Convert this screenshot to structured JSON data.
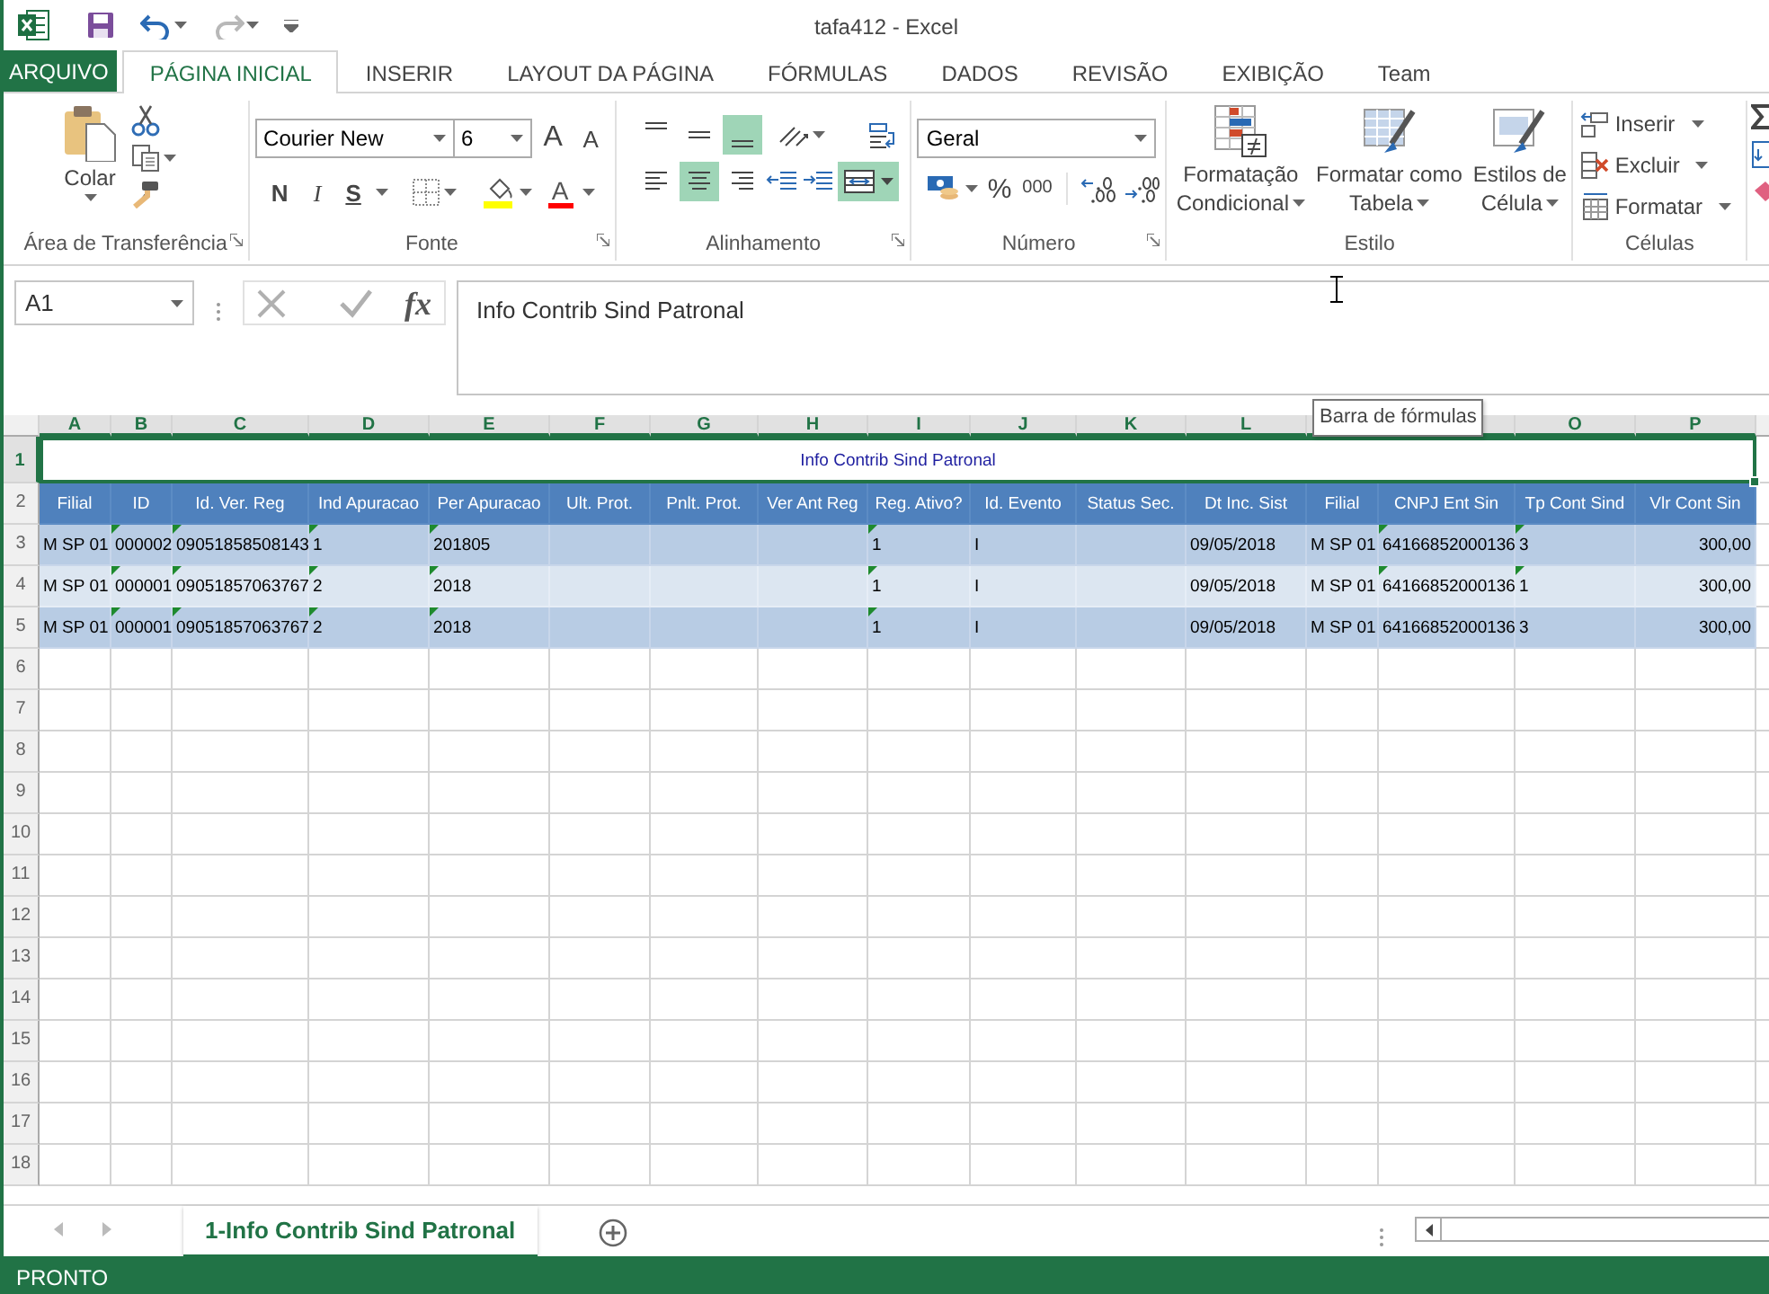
{
  "window": {
    "title": "tafa412 - Excel"
  },
  "quick_access": [
    {
      "kind": "save",
      "disabled": false
    },
    {
      "kind": "undo",
      "disabled": false
    },
    {
      "kind": "redo",
      "disabled": true
    }
  ],
  "file_tab": "ARQUIVO",
  "tabs": [
    {
      "label": "PÁGINA INICIAL",
      "selected": true
    },
    {
      "label": "INSERIR",
      "selected": false
    },
    {
      "label": "LAYOUT DA PÁGINA",
      "selected": false
    },
    {
      "label": "FÓRMULAS",
      "selected": false
    },
    {
      "label": "DADOS",
      "selected": false
    },
    {
      "label": "REVISÃO",
      "selected": false
    },
    {
      "label": "EXIBIÇÃO",
      "selected": false
    },
    {
      "label": "Team",
      "selected": false
    }
  ],
  "ribbon": {
    "clipboard": {
      "paste": "Colar",
      "label": "Área de Transferência"
    },
    "font": {
      "name": "Courier New",
      "size": "6",
      "grow": "A",
      "shrink": "A",
      "bold": "N",
      "italic": "I",
      "underline": "S",
      "color_button": "A",
      "label": "Fonte"
    },
    "alignment": {
      "label": "Alinhamento",
      "vertical": [
        {
          "kind": "top",
          "selected": false
        },
        {
          "kind": "middle",
          "selected": false
        },
        {
          "kind": "bottom",
          "selected": true
        }
      ],
      "horizontal": [
        {
          "kind": "left",
          "selected": false
        },
        {
          "kind": "center",
          "selected": true
        },
        {
          "kind": "right",
          "selected": false
        }
      ],
      "merge_selected": true
    },
    "number": {
      "format": "Geral",
      "percent": "%",
      "thousands": "000",
      "label": "Número"
    },
    "styles": {
      "label": "Estilo",
      "buttons": [
        {
          "kind": "conditional",
          "lines": [
            "Formatação",
            "Condicional"
          ]
        },
        {
          "kind": "table",
          "lines": [
            "Formatar como",
            "Tabela"
          ]
        },
        {
          "kind": "cell",
          "lines": [
            "Estilos de",
            "Célula"
          ]
        }
      ]
    },
    "cells": {
      "label": "Células",
      "buttons": [
        {
          "kind": "insert",
          "label": "Inserir"
        },
        {
          "kind": "delete",
          "label": "Excluir"
        },
        {
          "kind": "format",
          "label": "Formatar"
        }
      ]
    }
  },
  "formula_bar": {
    "name_box": "A1",
    "function_button": "fx",
    "formula": "Info Contrib Sind Patronal",
    "tooltip": "Barra de fórmulas"
  },
  "sheet": {
    "column_headers": [
      {
        "label": "A",
        "selected": true
      },
      {
        "label": "B",
        "selected": true
      },
      {
        "label": "C",
        "selected": true
      },
      {
        "label": "D",
        "selected": true
      },
      {
        "label": "E",
        "selected": true
      },
      {
        "label": "F",
        "selected": true
      },
      {
        "label": "G",
        "selected": true
      },
      {
        "label": "H",
        "selected": true
      },
      {
        "label": "I",
        "selected": true
      },
      {
        "label": "J",
        "selected": true
      },
      {
        "label": "K",
        "selected": true
      },
      {
        "label": "L",
        "selected": true
      },
      {
        "selected": true
      },
      {
        "selected": true
      },
      {
        "label": "O",
        "selected": true
      },
      {
        "label": "P",
        "selected": true
      }
    ],
    "rows": [
      {
        "number": "1",
        "selected": true,
        "kind": "title",
        "text": "Info Contrib Sind Patronal"
      },
      {
        "number": "2",
        "selected": false,
        "kind": "header",
        "cells": [
          "Filial",
          "ID",
          "Id. Ver. Reg",
          "Ind Apuracao",
          "Per Apuracao",
          "Ult. Prot.",
          "Pnlt. Prot.",
          "Ver Ant Reg",
          "Reg. Ativo?",
          "Id. Evento",
          "Status Sec.",
          "Dt Inc. Sist",
          "Filial",
          "CNPJ Ent Sin",
          "Tp Cont Sind",
          "Vlr Cont Sin"
        ]
      },
      {
        "number": "3",
        "selected": false,
        "kind": "data",
        "cells": [
          {
            "text": "M SP 01",
            "flag": false
          },
          {
            "text": "000002",
            "flag": true
          },
          {
            "text": "09051858508143",
            "flag": true
          },
          {
            "text": "1",
            "flag": true
          },
          {
            "text": "201805",
            "flag": true
          },
          {
            "flag": false
          },
          {
            "flag": false
          },
          {
            "flag": false
          },
          {
            "text": "1",
            "flag": true
          },
          {
            "text": "I",
            "flag": false
          },
          {
            "flag": false
          },
          {
            "text": "09/05/2018",
            "flag": false
          },
          {
            "text": "M SP 01",
            "flag": false
          },
          {
            "text": "64166852000136",
            "flag": true
          },
          {
            "text": "3",
            "flag": true
          },
          {
            "text": "300,00",
            "flag": false
          }
        ]
      },
      {
        "number": "4",
        "selected": false,
        "kind": "data",
        "cells": [
          {
            "text": "M SP 01",
            "flag": false
          },
          {
            "text": "000001",
            "flag": true
          },
          {
            "text": "09051857063767",
            "flag": true
          },
          {
            "text": "2",
            "flag": true
          },
          {
            "text": "2018",
            "flag": true
          },
          {
            "flag": false
          },
          {
            "flag": false
          },
          {
            "flag": false
          },
          {
            "text": "1",
            "flag": true
          },
          {
            "text": "I",
            "flag": false
          },
          {
            "flag": false
          },
          {
            "text": "09/05/2018",
            "flag": false
          },
          {
            "text": "M SP 01",
            "flag": false
          },
          {
            "text": "64166852000136",
            "flag": true
          },
          {
            "text": "1",
            "flag": true
          },
          {
            "text": "300,00",
            "flag": false
          }
        ]
      },
      {
        "number": "5",
        "selected": false,
        "kind": "data",
        "cells": [
          {
            "text": "M SP 01",
            "flag": false
          },
          {
            "text": "000001",
            "flag": true
          },
          {
            "text": "09051857063767",
            "flag": true
          },
          {
            "text": "2",
            "flag": true
          },
          {
            "text": "2018",
            "flag": true
          },
          {
            "flag": false
          },
          {
            "flag": false
          },
          {
            "flag": false
          },
          {
            "text": "1",
            "flag": true
          },
          {
            "text": "I",
            "flag": false
          },
          {
            "flag": false
          },
          {
            "text": "09/05/2018",
            "flag": false
          },
          {
            "text": "M SP 01",
            "flag": false
          },
          {
            "text": "64166852000136",
            "flag": false
          },
          {
            "text": "3",
            "flag": false
          },
          {
            "text": "300,00",
            "flag": false
          }
        ]
      },
      {
        "number": "6",
        "selected": false,
        "kind": "empty"
      },
      {
        "number": "7",
        "selected": false,
        "kind": "empty"
      },
      {
        "number": "8",
        "selected": false,
        "kind": "empty"
      },
      {
        "number": "9",
        "selected": false,
        "kind": "empty"
      },
      {
        "number": "10",
        "selected": false,
        "kind": "empty"
      },
      {
        "number": "11",
        "selected": false,
        "kind": "empty"
      },
      {
        "number": "12",
        "selected": false,
        "kind": "empty"
      },
      {
        "number": "13",
        "selected": false,
        "kind": "empty"
      },
      {
        "number": "14",
        "selected": false,
        "kind": "empty"
      },
      {
        "number": "15",
        "selected": false,
        "kind": "empty"
      },
      {
        "number": "16",
        "selected": false,
        "kind": "empty"
      },
      {
        "number": "17",
        "selected": false,
        "kind": "empty"
      },
      {
        "number": "18",
        "selected": false,
        "kind": "empty"
      }
    ]
  },
  "sheet_tabs": [
    {
      "label": "1-Info Contrib Sind Patronal",
      "selected": true
    }
  ],
  "status_bar": {
    "text": "PRONTO"
  }
}
